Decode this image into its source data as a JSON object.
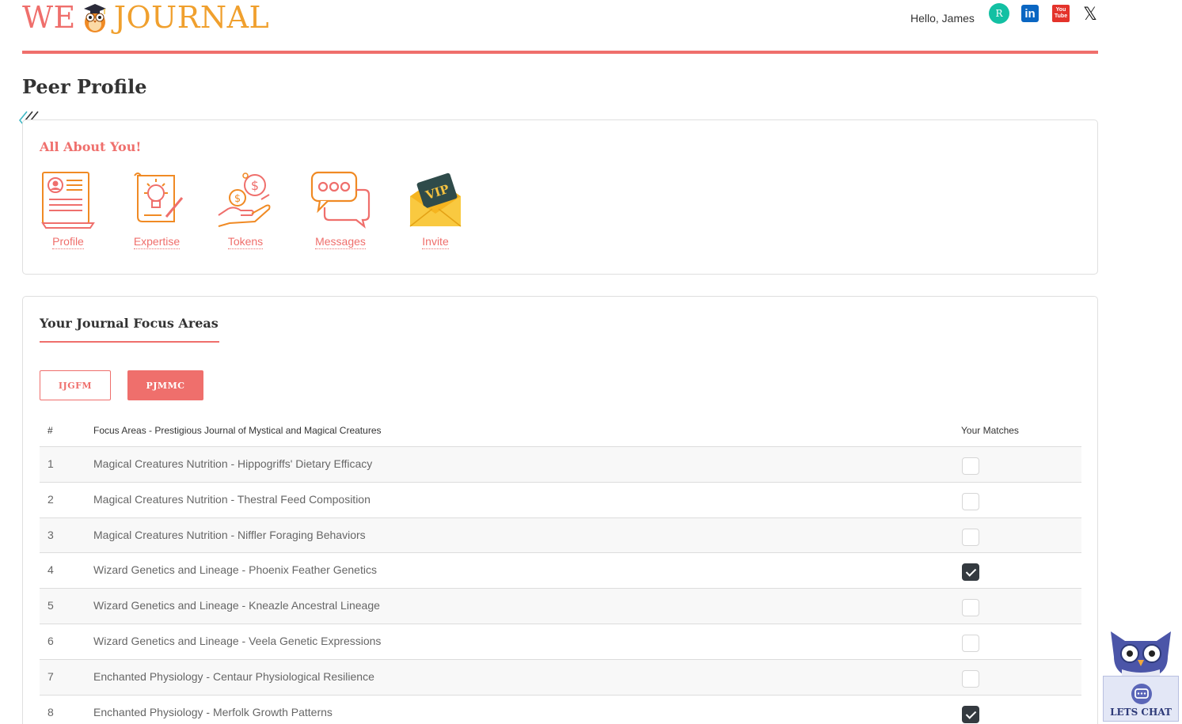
{
  "header": {
    "logo_we": "WE",
    "logo_journal": "JOURNAL",
    "greeting": "Hello, James",
    "social": {
      "researchgate": "R",
      "linkedin": "in",
      "youtube": "You Tube",
      "x": "𝕏"
    }
  },
  "page_title": "Peer Profile",
  "about": {
    "title": "All About You!",
    "items": [
      {
        "label": "Profile",
        "icon": "profile-document-icon"
      },
      {
        "label": "Expertise",
        "icon": "lightbulb-scroll-icon"
      },
      {
        "label": "Tokens",
        "icon": "coins-hand-icon"
      },
      {
        "label": "Messages",
        "icon": "chat-bubbles-icon"
      },
      {
        "label": "Invite",
        "icon": "vip-envelope-icon"
      }
    ]
  },
  "focus": {
    "title": "Your Journal Focus Areas",
    "journals": [
      "IJGFM",
      "PJMMC"
    ],
    "selected_journal": "PJMMC",
    "table": {
      "headers": {
        "num": "#",
        "area": "Focus Areas - Prestigious Journal of Mystical and Magical Creatures",
        "matches": "Your Matches"
      },
      "rows": [
        {
          "num": "1",
          "area": "Magical Creatures Nutrition - Hippogriffs' Dietary Efficacy",
          "match": false
        },
        {
          "num": "2",
          "area": "Magical Creatures Nutrition - Thestral Feed Composition",
          "match": false
        },
        {
          "num": "3",
          "area": "Magical Creatures Nutrition - Niffler Foraging Behaviors",
          "match": false
        },
        {
          "num": "4",
          "area": "Wizard Genetics and Lineage - Phoenix Feather Genetics",
          "match": true
        },
        {
          "num": "5",
          "area": "Wizard Genetics and Lineage - Kneazle Ancestral Lineage",
          "match": false
        },
        {
          "num": "6",
          "area": "Wizard Genetics and Lineage - Veela Genetic Expressions",
          "match": false
        },
        {
          "num": "7",
          "area": "Enchanted Physiology - Centaur Physiological Resilience",
          "match": false
        },
        {
          "num": "8",
          "area": "Enchanted Physiology - Merfolk Growth Patterns",
          "match": true
        }
      ]
    }
  },
  "chat": {
    "label": "LETS CHAT"
  },
  "colors": {
    "accent": "#ef6f6c",
    "logo_orange": "#f0a02e",
    "checked": "#343a40"
  }
}
